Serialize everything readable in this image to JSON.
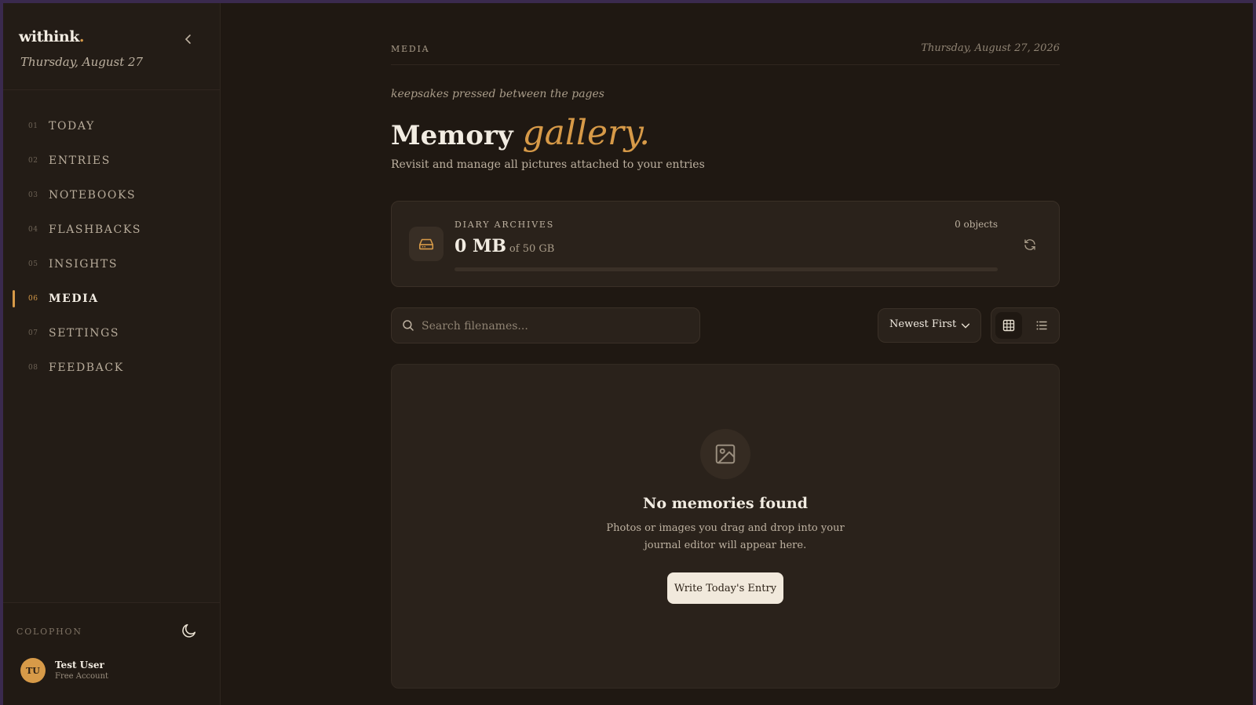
{
  "sidebar": {
    "brand": "withink",
    "brand_dot": ".",
    "date": "Thursday, August 27",
    "items": [
      {
        "num": "01",
        "label": "TODAY"
      },
      {
        "num": "02",
        "label": "ENTRIES"
      },
      {
        "num": "03",
        "label": "NOTEBOOKS"
      },
      {
        "num": "04",
        "label": "FLASHBACKS"
      },
      {
        "num": "05",
        "label": "INSIGHTS"
      },
      {
        "num": "06",
        "label": "MEDIA",
        "active": true
      },
      {
        "num": "07",
        "label": "SETTINGS"
      },
      {
        "num": "08",
        "label": "FEEDBACK"
      }
    ],
    "colophon": "COLOPHON",
    "user": {
      "initials": "TU",
      "name": "Test User",
      "plan": "Free Account"
    }
  },
  "header": {
    "crumb": "MEDIA",
    "date": "Thursday, August 27, 2026",
    "tagline": "keepsakes pressed between the pages",
    "title": "Memory",
    "title_accent": "gallery.",
    "subtitle": "Revisit and manage all pictures attached to your entries"
  },
  "storage": {
    "label": "DIARY ARCHIVES",
    "value": "0 MB",
    "of": "of 50 GB",
    "count": "0 objects",
    "used_fraction": 0
  },
  "toolbar": {
    "search_placeholder": "Search filenames...",
    "sort_label": "Newest First"
  },
  "empty": {
    "title": "No memories found",
    "description": "Photos or images you drag and drop into your journal editor will appear here.",
    "cta": "Write Today's Entry"
  },
  "colors": {
    "accent": "#d79a48",
    "background": "#1f1812",
    "panel": "#2a221b"
  },
  "icons": [
    "chevron-left-icon",
    "moon-icon",
    "drive-icon",
    "refresh-icon",
    "search-icon",
    "chevron-down-icon",
    "grid-icon",
    "list-icon",
    "image-icon"
  ]
}
